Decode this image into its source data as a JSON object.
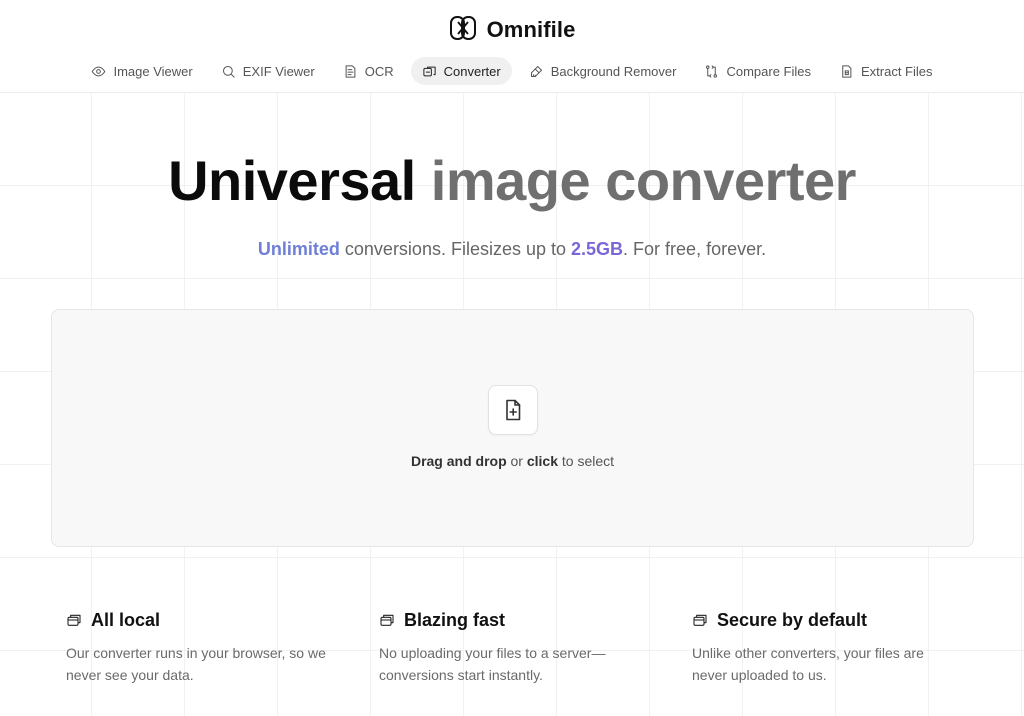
{
  "brand": {
    "name": "Omnifile"
  },
  "nav": {
    "items": [
      {
        "label": "Image Viewer",
        "icon": "eye-icon"
      },
      {
        "label": "EXIF Viewer",
        "icon": "search-icon"
      },
      {
        "label": "OCR",
        "icon": "document-text-icon"
      },
      {
        "label": "Converter",
        "icon": "convert-icon",
        "active": true
      },
      {
        "label": "Background Remover",
        "icon": "brush-icon"
      },
      {
        "label": "Compare Files",
        "icon": "compare-icon"
      },
      {
        "label": "Extract Files",
        "icon": "file-extract-icon"
      }
    ]
  },
  "hero": {
    "title_part1": "Universal",
    "title_part2": "image converter",
    "subtitle_hl1": "Unlimited",
    "subtitle_mid": " conversions. Filesizes up to ",
    "subtitle_hl2": "2.5GB",
    "subtitle_end": ". For free, forever."
  },
  "dropzone": {
    "icon": "file-plus-icon",
    "bold1": "Drag and drop",
    "mid": " or ",
    "bold2": "click",
    "end": " to select"
  },
  "features": [
    {
      "icon": "window-stack-icon",
      "title": "All local",
      "desc": "Our converter runs in your browser, so we never see your data."
    },
    {
      "icon": "window-stack-icon",
      "title": "Blazing fast",
      "desc": "No uploading your files to a server—conversions start instantly."
    },
    {
      "icon": "window-stack-icon",
      "title": "Secure by default",
      "desc": "Unlike other converters, your files are never uploaded to us."
    }
  ],
  "colors": {
    "accent_blue": "#6f7fd8",
    "accent_purple": "#7a66d6",
    "title_gray": "#6f6f6f"
  }
}
